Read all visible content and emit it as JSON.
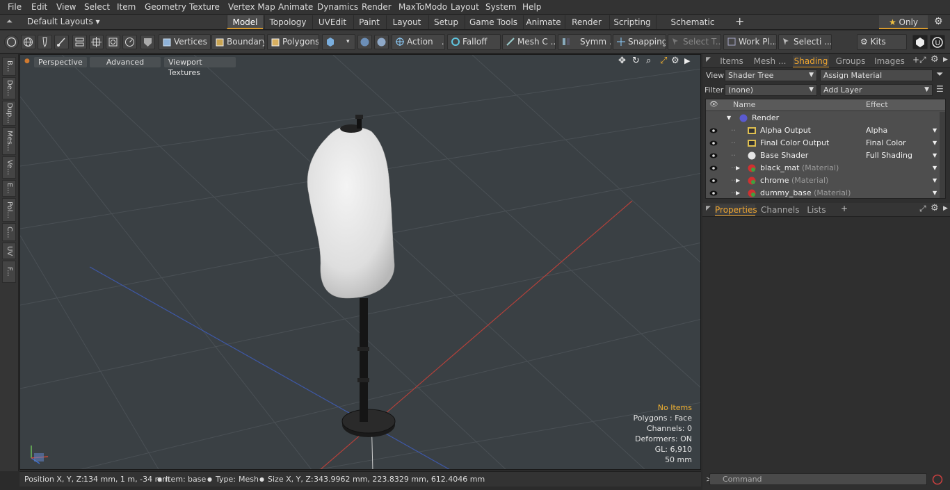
{
  "menu": [
    "File",
    "Edit",
    "View",
    "Select",
    "Item",
    "Geometry",
    "Texture",
    "Vertex Map",
    "Animate",
    "Dynamics",
    "Render",
    "MaxToModo",
    "Layout",
    "System",
    "Help"
  ],
  "layoutbar": {
    "layouts_label": "Default Layouts",
    "tabs": [
      "Model",
      "Topology",
      "UVEdit",
      "Paint",
      "Layout",
      "Setup",
      "Game Tools",
      "Animate",
      "Render",
      "Scripting",
      "Schematic Fusion"
    ],
    "active_tab": "Model",
    "plus": "+",
    "only_label": "Only"
  },
  "toolbar": {
    "vertices": "Vertices",
    "boundary": "Boundary",
    "polygons": "Polygons",
    "action": "Action",
    "falloff": "Falloff",
    "meshc": "Mesh C ...",
    "symm": "Symm ...",
    "snapping": "Snapping",
    "selectt": "Select T...",
    "workpl": "Work Pl...",
    "selecti": "Selecti ...",
    "kits": "Kits"
  },
  "left_tabs": [
    "B...",
    "De...",
    "Dup...",
    "Mes...",
    "Ve...",
    "E...",
    "Pol...",
    "C...",
    "UV",
    "F..."
  ],
  "viewport": {
    "buttons": [
      "Perspective",
      "Advanced",
      "Viewport Textures"
    ],
    "info": [
      "No Items",
      "Polygons : Face",
      "Channels: 0",
      "Deformers: ON",
      "GL: 6,910",
      "50 mm"
    ]
  },
  "status": {
    "position_label": "Position X, Y, Z:",
    "position_value": "134 mm, 1 m, -34 mm",
    "item_label": "Item:",
    "item_value": "base",
    "type_label": "Type:",
    "type_value": "Mesh",
    "size_label": "Size X, Y, Z:",
    "size_value": "343.9962 mm, 223.8329 mm, 612.4046 mm"
  },
  "right": {
    "tabs": [
      "Items",
      "Mesh ...",
      "Shading",
      "Groups",
      "Images"
    ],
    "active_tab": "Shading",
    "view_label": "View",
    "view_value": "Shader Tree",
    "assign_material": "Assign Material",
    "filter_label": "Filter",
    "filter_value": "(none)",
    "add_layer": "Add Layer",
    "col_name": "Name",
    "col_effect": "Effect",
    "rows": [
      {
        "name": "Render",
        "suffix": "",
        "effect": ""
      },
      {
        "name": "Alpha Output",
        "suffix": "",
        "effect": "Alpha"
      },
      {
        "name": "Final Color Output",
        "suffix": "",
        "effect": "Final Color"
      },
      {
        "name": "Base Shader",
        "suffix": "",
        "effect": "Full Shading"
      },
      {
        "name": "black_mat",
        "suffix": "(Material)",
        "effect": ""
      },
      {
        "name": "chrome",
        "suffix": "(Material)",
        "effect": ""
      },
      {
        "name": "dummy_base",
        "suffix": "(Material)",
        "effect": ""
      }
    ],
    "lower_tabs": [
      "Properties",
      "Channels",
      "Lists"
    ],
    "lower_active": "Properties",
    "lower_plus": "+",
    "command_placeholder": "Command"
  }
}
